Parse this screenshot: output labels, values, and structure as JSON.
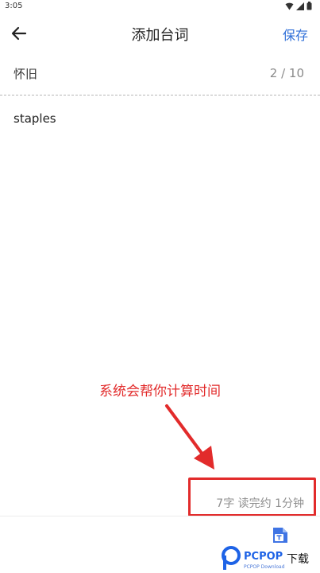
{
  "status_bar": {
    "time": "3:05"
  },
  "app_bar": {
    "title": "添加台词",
    "save_label": "保存"
  },
  "tag": {
    "name": "怀旧",
    "count": "2 / 10"
  },
  "editor": {
    "text": "staples"
  },
  "annotation": {
    "text": "系统会帮你计算时间",
    "color": "#e22b2b"
  },
  "stats": {
    "text": "7字  读完约 1分钟"
  },
  "teleprompter": {
    "icon": "document-t-icon"
  },
  "watermark": {
    "brand": "PCPOP",
    "suffix": "下载",
    "sub": "PCPOP Download"
  },
  "colors": {
    "accent": "#2f6fd8",
    "annotation": "#e22b2b",
    "muted": "#8f8f8f"
  }
}
